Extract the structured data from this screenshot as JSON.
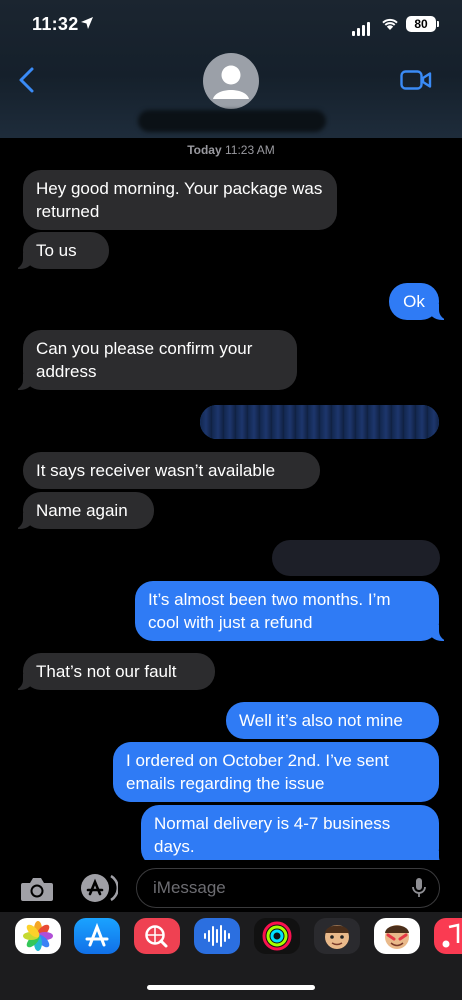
{
  "status": {
    "time": "11:32",
    "battery": "80"
  },
  "header": {
    "timestamp_day": "Today",
    "timestamp_time": "11:23 AM"
  },
  "messages": [
    {
      "dir": "in",
      "text": "Hey good morning. Your package was returned"
    },
    {
      "dir": "in",
      "text": "To us"
    },
    {
      "dir": "out",
      "text": "Ok"
    },
    {
      "dir": "in",
      "text": "Can you please confirm your address"
    },
    {
      "dir": "out",
      "text": "",
      "redacted": true
    },
    {
      "dir": "in",
      "text": "It says receiver wasn’t available"
    },
    {
      "dir": "in",
      "text": "Name again"
    },
    {
      "dir": "out",
      "text": "",
      "redacted": true
    },
    {
      "dir": "out",
      "text": "It’s almost been two months. I’m cool with just a refund"
    },
    {
      "dir": "in",
      "text": "That’s not our fault"
    },
    {
      "dir": "out",
      "text": "Well it’s also not mine"
    },
    {
      "dir": "out",
      "text": "I ordered on October 2nd. I’ve sent emails regarding the issue"
    },
    {
      "dir": "out",
      "text": "Normal delivery is 4-7 business days."
    }
  ],
  "composer": {
    "placeholder": "iMessage"
  },
  "apps": [
    "photos-app-icon",
    "app-store-icon",
    "web-search-app-icon",
    "audio-message-icon",
    "activity-rings-icon",
    "memoji-icon",
    "memoji-stickers-icon",
    "music-app-icon"
  ],
  "colors": {
    "outgoing": "#2f7bf5",
    "incoming": "#2c2c2e",
    "accent": "#3a8bf6"
  }
}
